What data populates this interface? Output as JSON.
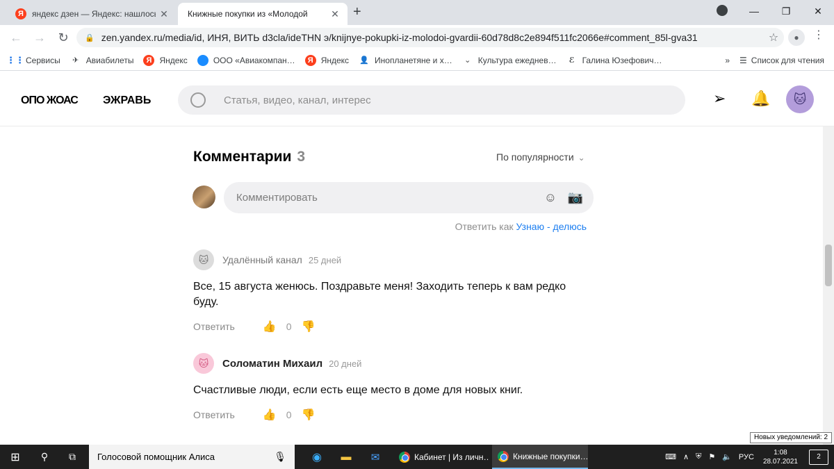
{
  "browser": {
    "tabs": [
      {
        "title": "яндекс дзен — Яндекс: нашлось",
        "favicon": "Я",
        "active": false
      },
      {
        "title": "Книжные покупки из «Молодой",
        "active": true
      }
    ],
    "url": "zen.yandex.ru/media/id, ИНЯ, ВИТЬ d3cla/ideTHN э/knijnye-pokupki-iz-molodoi-gvardii-60d78d8c2e894f511fc2066e#comment_85l-gva31",
    "bookmarks": [
      {
        "label": "Сервисы",
        "icon": "apps-grid-icon"
      },
      {
        "label": "Авиабилеты",
        "icon": "airplane-icon"
      },
      {
        "label": "Яндекс",
        "icon": "Я"
      },
      {
        "label": "ООО «Авиакомпан…",
        "icon": "blue-circle-icon"
      },
      {
        "label": "Яндекс",
        "icon": "Я"
      },
      {
        "label": "Инопланетяне и х…",
        "icon": "person-icon"
      },
      {
        "label": "Культура ежеднев…",
        "icon": "chevron-icon"
      },
      {
        "label": "Галина Юзефович…",
        "icon": "g-logo-icon"
      }
    ],
    "more_bookmarks": "»",
    "reading_list": "Список для чтения"
  },
  "site": {
    "logo_left": "ОПО ЖОАС",
    "logo_right": "ЭЖРАВЬ",
    "search_placeholder": "Статья, видео, канал, интерес"
  },
  "comments_section": {
    "title": "Комментарии",
    "count": "3",
    "sort_label": "По популярности",
    "input_placeholder": "Комментировать",
    "reply_as_prefix": "Ответить как",
    "reply_as_name": "Узнаю - делюсь"
  },
  "comments": [
    {
      "author": "Удалённый канал",
      "date": "25 дней",
      "text": "Все, 15 августа женюсь. Поздравьте меня! Заходить теперь к вам редко буду.",
      "reply_label": "Ответить",
      "likes": "0"
    },
    {
      "author": "Соломатин Михаил",
      "date": "20 дней",
      "text": "Счастливые люди, если есть еще место в доме для новых книг.",
      "reply_label": "Ответить",
      "likes": "0"
    }
  ],
  "notification_tooltip": "Новых уведомлений: 2",
  "taskbar": {
    "search_text": "Голосовой помощник Алиса",
    "apps": [
      {
        "label": "Кабинет | Из личн…",
        "active": false
      },
      {
        "label": "Книжные покупки…",
        "active": true
      }
    ],
    "language": "РУС",
    "time": "1:08",
    "date": "28.07.2021",
    "notification_count": "2"
  }
}
